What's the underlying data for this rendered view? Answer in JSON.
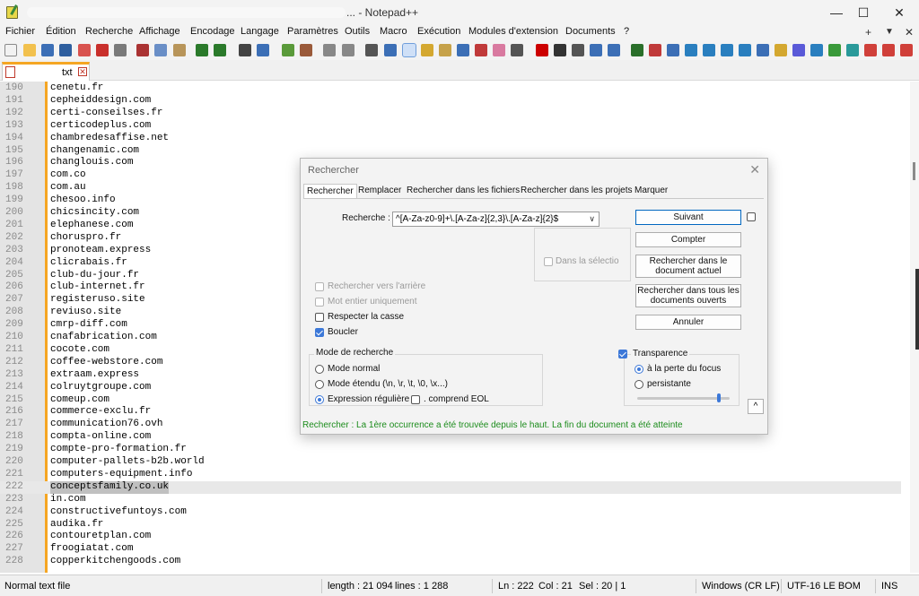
{
  "window": {
    "title": "... - Notepad++",
    "controls": [
      "—",
      "☐",
      "✕"
    ]
  },
  "menu": {
    "items": [
      "Fichier",
      "Édition",
      "Recherche",
      "Affichage",
      "Encodage",
      "Langage",
      "Paramètres",
      "Outils",
      "Macro",
      "Exécution",
      "Modules d'extension",
      "Documents",
      "?"
    ],
    "right": [
      "+",
      "▼",
      "✕"
    ]
  },
  "tab": {
    "label": "txt",
    "close": "✕"
  },
  "editor": {
    "current_line": 222,
    "lines": [
      {
        "n": "190",
        "t": "cenetu.fr"
      },
      {
        "n": "191",
        "t": "cepheiddesign.com"
      },
      {
        "n": "192",
        "t": "certi-conseilses.fr"
      },
      {
        "n": "193",
        "t": "certicodeplus.com"
      },
      {
        "n": "194",
        "t": "chambredesaffise.net"
      },
      {
        "n": "195",
        "t": "changenamic.com"
      },
      {
        "n": "196",
        "t": "changlouis.com"
      },
      {
        "n": "197",
        "t": "com.co"
      },
      {
        "n": "198",
        "t": "com.au"
      },
      {
        "n": "199",
        "t": "chesoo.info"
      },
      {
        "n": "200",
        "t": "chicsincity.com"
      },
      {
        "n": "201",
        "t": "elephanese.com"
      },
      {
        "n": "202",
        "t": "choruspro.fr"
      },
      {
        "n": "203",
        "t": "pronoteam.express"
      },
      {
        "n": "204",
        "t": "clicrabais.fr"
      },
      {
        "n": "205",
        "t": "club-du-jour.fr"
      },
      {
        "n": "206",
        "t": "club-internet.fr"
      },
      {
        "n": "207",
        "t": "registeruso.site"
      },
      {
        "n": "208",
        "t": "reviuso.site"
      },
      {
        "n": "209",
        "t": "cmrp-diff.com"
      },
      {
        "n": "210",
        "t": "cnafabrication.com"
      },
      {
        "n": "211",
        "t": "cocote.com"
      },
      {
        "n": "212",
        "t": "coffee-webstore.com"
      },
      {
        "n": "213",
        "t": "extraam.express"
      },
      {
        "n": "214",
        "t": "colruytgroupe.com"
      },
      {
        "n": "215",
        "t": "comeup.com"
      },
      {
        "n": "216",
        "t": "commerce-exclu.fr"
      },
      {
        "n": "217",
        "t": "communication76.ovh"
      },
      {
        "n": "218",
        "t": "compta-online.com"
      },
      {
        "n": "219",
        "t": "compte-pro-formation.fr"
      },
      {
        "n": "220",
        "t": "computer-pallets-b2b.world"
      },
      {
        "n": "221",
        "t": "computers-equipment.info"
      },
      {
        "n": "222",
        "t": "conceptsfamily.co.uk"
      },
      {
        "n": "223",
        "t": "in.com"
      },
      {
        "n": "224",
        "t": "constructivefuntoys.com"
      },
      {
        "n": "225",
        "t": "audika.fr"
      },
      {
        "n": "226",
        "t": "contouretplan.com"
      },
      {
        "n": "227",
        "t": "froogiatat.com"
      },
      {
        "n": "228",
        "t": "copperkitchengoods.com"
      }
    ]
  },
  "status": {
    "file_type": "Normal text file",
    "length": "length : 21 094",
    "lines": "lines : 1 288",
    "ln": "Ln : 222",
    "col": "Col : 21",
    "sel": "Sel : 20 | 1",
    "eol": "Windows (CR LF)",
    "encoding": "UTF-16 LE BOM",
    "mode": "INS"
  },
  "dialog": {
    "title": "Rechercher",
    "close": "✕",
    "tabs": [
      "Rechercher",
      "Remplacer",
      "Rechercher dans les fichiers",
      "Rechercher dans les projets",
      "Marquer"
    ],
    "search_label": "Recherche :",
    "search_value": "^[A-Za-z0-9]+\\.[A-Za-z]{2,3}\\.[A-Za-z]{2}$",
    "combo_arrow": "∨",
    "in_selection": "Dans la sélectio",
    "buttons": {
      "next": "Suivant",
      "count": "Compter",
      "find_in_current": "Rechercher dans le document actuel",
      "find_in_all": "Rechercher dans tous les documents ouverts",
      "cancel": "Annuler",
      "collapse": "^"
    },
    "options": {
      "backward": "Rechercher vers l'arrière",
      "whole_word": "Mot entier uniquement",
      "match_case": "Respecter la casse",
      "wrap": "Boucler"
    },
    "mode": {
      "title": "Mode de recherche",
      "normal": "Mode normal",
      "extended": "Mode étendu (\\n, \\r, \\t, \\0, \\x...)",
      "regex": "Expression régulière",
      "eol": ". comprend EOL",
      "selected": "regex"
    },
    "transparency": {
      "title": "Transparence",
      "on_focus_loss": "à la perte du focus",
      "always": "persistante",
      "level": 0.88
    },
    "status_message": "Rechercher : La 1ère occurrence a été trouvée depuis le haut. La fin du document a été atteinte"
  }
}
